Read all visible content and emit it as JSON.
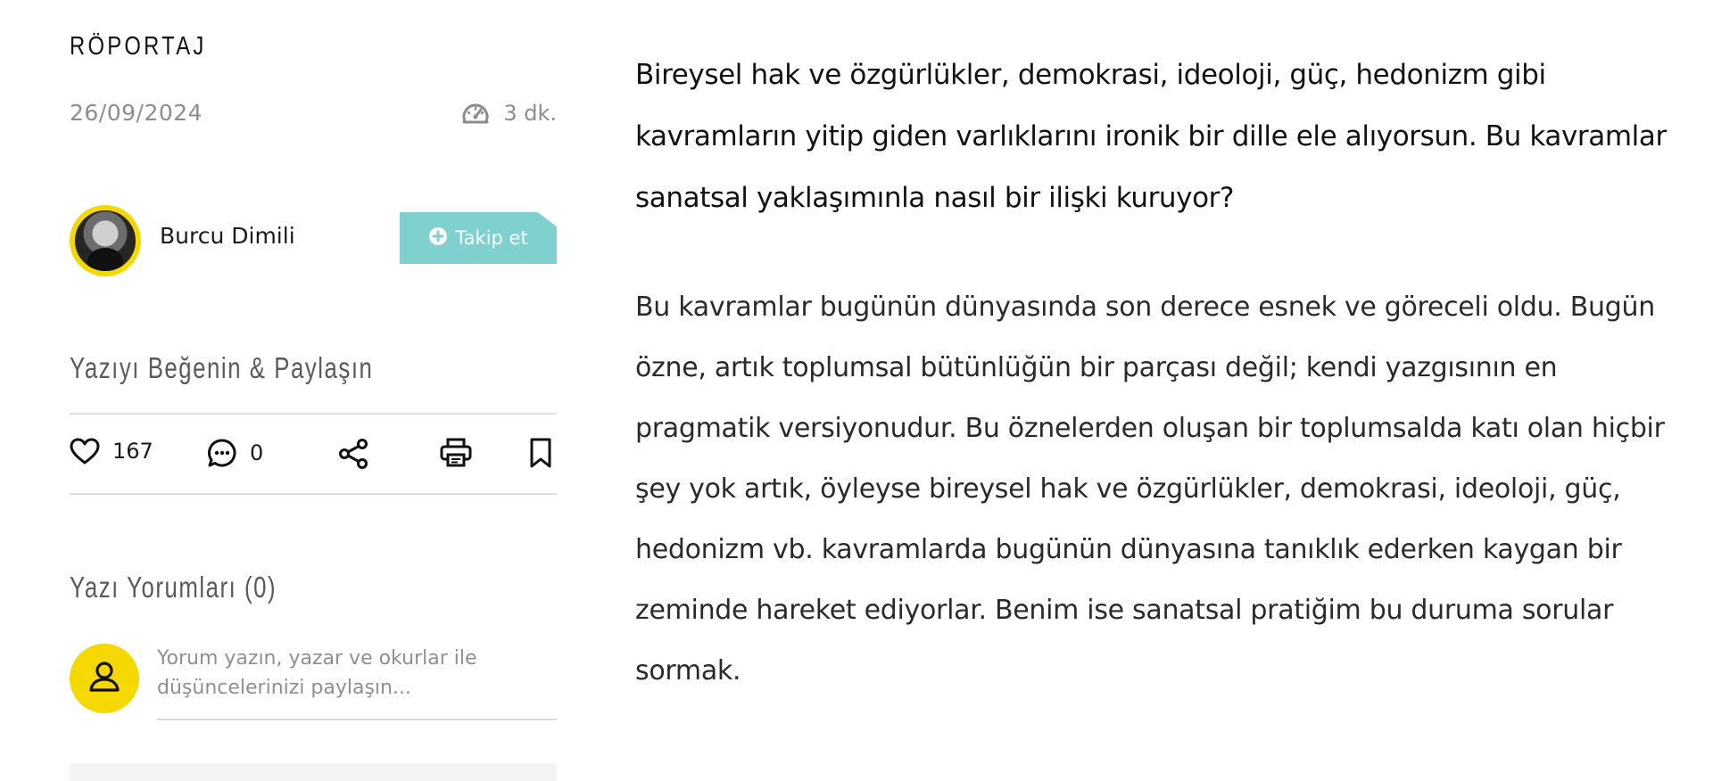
{
  "sidebar": {
    "category": "RÖPORTAJ",
    "date": "26/09/2024",
    "read_time": "3 dk.",
    "author": {
      "name": "Burcu Dimili",
      "follow_label": "Takip et"
    },
    "like_share_title": "Yazıyı Beğenin & Paylaşın",
    "actions": {
      "likes": "167",
      "comments": "0"
    },
    "comments_title": "Yazı Yorumları (0)",
    "comment_placeholder": "Yorum yazın, yazar ve okurlar ile düşüncelerinizi paylaşın..."
  },
  "article": {
    "question": "Bireysel hak ve özgürlükler, demokrasi, ideoloji, güç, hedonizm gibi kavramların yitip giden varlıklarını ironik bir dille ele alıyorsun. Bu kavramlar sanatsal yaklaşımınla nasıl bir ilişki kuruyor?",
    "answer": "Bu kavramlar bugünün dünyasında son derece esnek ve göreceli oldu. Bugün özne, artık toplumsal bütünlüğün bir parçası değil; kendi yazgısının en pragmatik versiyonudur. Bu öznelerden oluşan bir toplumsalda katı olan hiçbir şey yok artık, öyleyse bireysel hak ve özgürlükler, demokrasi, ideoloji, güç, hedonizm vb. kavramlarda bugünün dünyasına tanıklık ederken kaygan bir zeminde hareket ediyorlar. Benim ise sanatsal pratiğim bu duruma sorular sormak."
  },
  "colors": {
    "accent_yellow": "#f5d800",
    "follow_button": "#7fd1cf",
    "muted_text": "#8d8d8d",
    "divider": "#dedede"
  },
  "icons": {
    "read_time": "speedometer-icon",
    "follow": "plus-circle-icon",
    "like": "heart-icon",
    "comment": "chat-bubble-icon",
    "share": "share-icon",
    "print": "printer-icon",
    "bookmark": "bookmark-icon",
    "user": "user-icon"
  }
}
